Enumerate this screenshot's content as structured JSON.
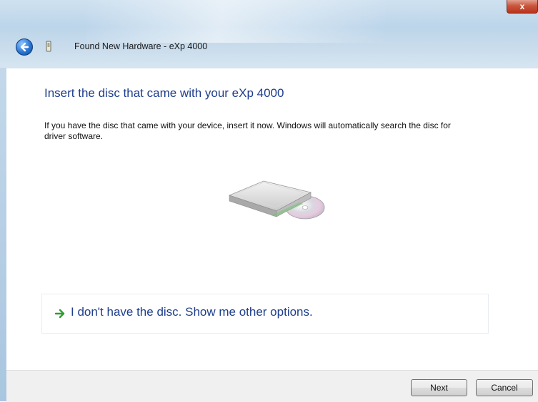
{
  "window": {
    "title": "Found New Hardware - eXp 4000",
    "close_label": "x"
  },
  "main": {
    "heading": "Insert the disc that came with your eXp 4000",
    "description": "If you have the disc that came with your device, insert it now.  Windows will automatically search the disc for driver software.",
    "illustration_icon": "optical-drive-disc-icon",
    "option": {
      "icon": "green-arrow-icon",
      "label": "I don't have the disc.  Show me other options."
    }
  },
  "footer": {
    "next_label": "Next",
    "cancel_label": "Cancel"
  },
  "colors": {
    "heading": "#1e3e8c",
    "option_arrow": "#2e9e2e",
    "close_button": "#c9573e"
  }
}
